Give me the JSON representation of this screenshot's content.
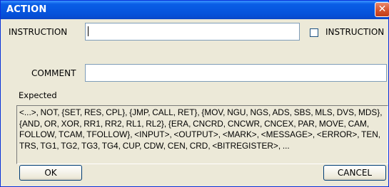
{
  "window": {
    "title": "ACTION",
    "close_glyph": "✕",
    "close_icon": "close-icon"
  },
  "form": {
    "instruction_label": "INSTRUCTION",
    "instruction_value": "",
    "instruction_checkbox_label": "INSTRUCTION",
    "instruction_checkbox_checked": false,
    "comment_label": "COMMENT",
    "comment_value": ""
  },
  "expected": {
    "label": "Expected",
    "text": "<...>, NOT, {SET, RES, CPL}, {JMP, CALL, RET}, {MOV, NGU, NGS, ADS, SBS, MLS, DVS, MDS}, {AND, OR, XOR, RR1, RR2, RL1, RL2}, {ERA, CNCRD, CNCWR, CNCEX, PAR, MOVE, CAM, FOLLOW, TCAM, TFOLLOW}, <INPUT>, <OUTPUT>, <MARK>, <MESSAGE>, <ERROR>, TEN, TRS, TG1, TG2, TG3, TG4, CUP, CDW, CEN, CRD, <BITREGISTER>, ..."
  },
  "buttons": {
    "ok": "OK",
    "cancel": "CANCEL"
  },
  "colors": {
    "titlebar": "#0550d8",
    "dialog_bg": "#ece9d8",
    "close": "#d2502a"
  }
}
